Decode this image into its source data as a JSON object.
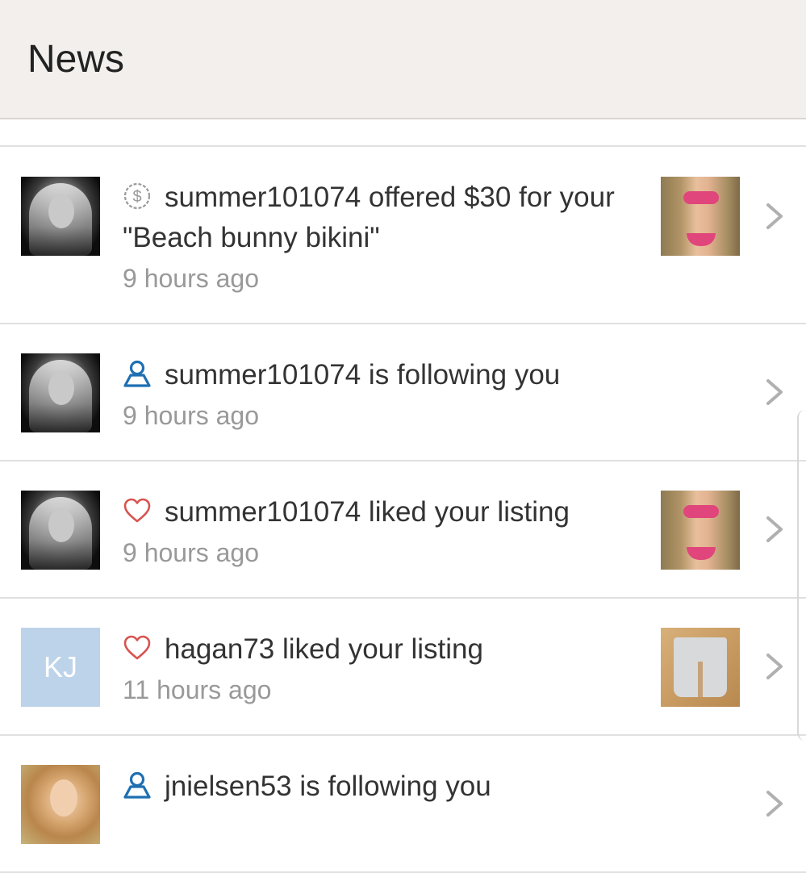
{
  "header": {
    "title": "News"
  },
  "items": [
    {
      "avatar_type": "photo",
      "icon": "offer-dollar-icon",
      "message": "summer101074 offered $30 for your \"Beach bunny bikini\"",
      "time": "9 hours ago",
      "thumbnail": "bikini-listing-photo"
    },
    {
      "avatar_type": "photo",
      "icon": "follow-person-icon",
      "message": "summer101074 is following you",
      "time": "9 hours ago",
      "thumbnail": null
    },
    {
      "avatar_type": "photo",
      "icon": "heart-like-icon",
      "message": "summer101074 liked your listing",
      "time": "9 hours ago",
      "thumbnail": "bikini-listing-photo"
    },
    {
      "avatar_type": "initials",
      "avatar_initials": "KJ",
      "icon": "heart-like-icon",
      "message": "hagan73 liked your listing",
      "time": "11 hours ago",
      "thumbnail": "shorts-listing-photo"
    },
    {
      "avatar_type": "photo",
      "icon": "follow-person-icon",
      "message": "jnielsen53 is following you",
      "time": "",
      "thumbnail": null
    }
  ],
  "colors": {
    "header_bg": "#f2efec",
    "offer_icon": "#9a9a9a",
    "follow_icon": "#1f6fb2",
    "like_icon": "#d9534f",
    "chevron": "#b0b0b0",
    "initials_bg": "#bcd3ea"
  }
}
